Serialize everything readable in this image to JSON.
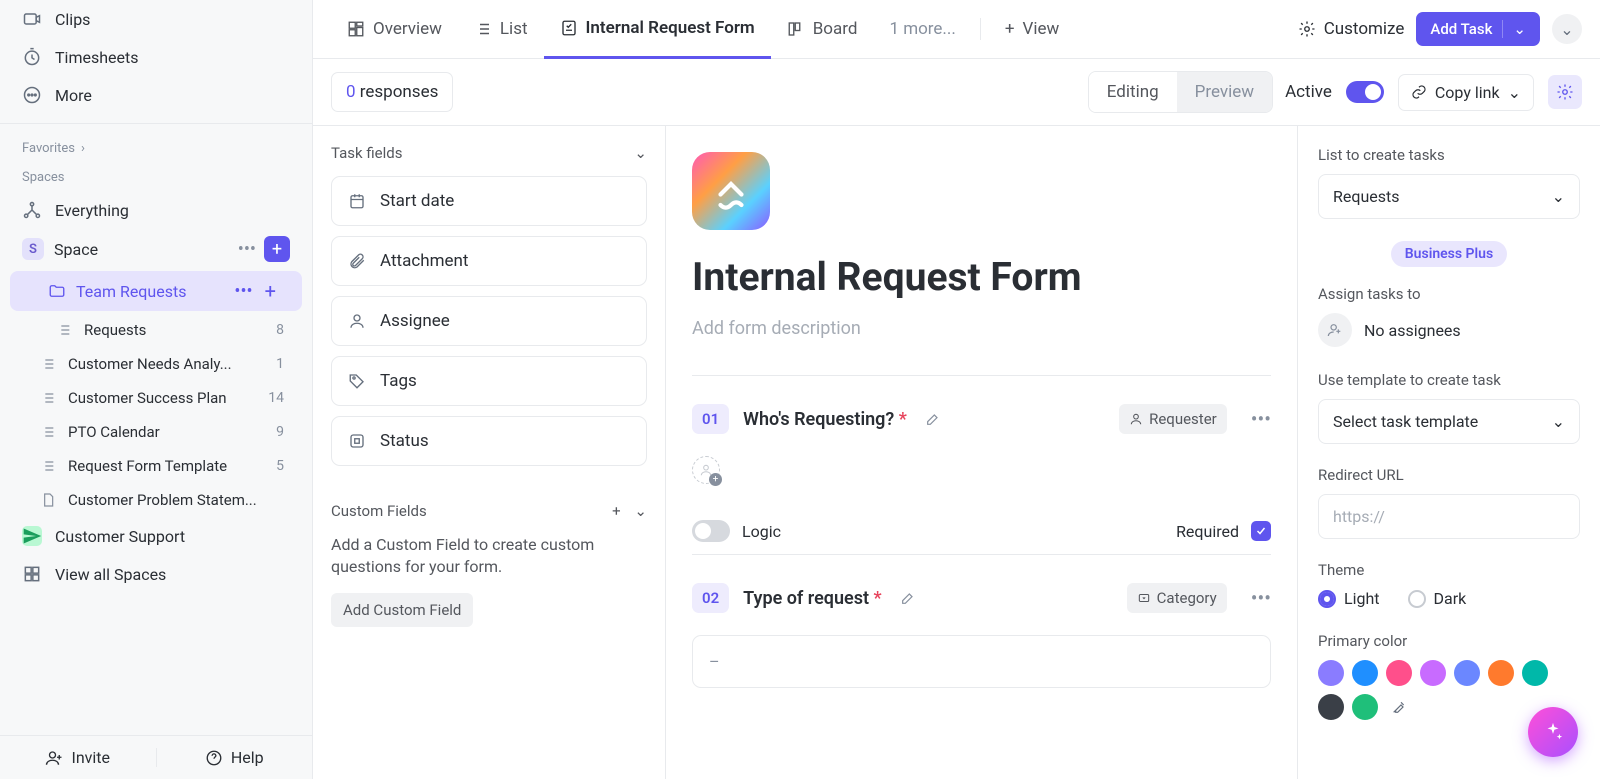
{
  "sidebar": {
    "items": [
      {
        "label": "Clips"
      },
      {
        "label": "Timesheets"
      },
      {
        "label": "More"
      }
    ],
    "favorites_label": "Favorites",
    "spaces_label": "Spaces",
    "everything": "Everything",
    "space": {
      "initial": "S",
      "name": "Space"
    },
    "folder": "Team Requests",
    "lists": [
      {
        "name": "Requests",
        "count": "8"
      },
      {
        "name": "Customer Needs Analy...",
        "count": "1"
      },
      {
        "name": "Customer Success Plan",
        "count": "14"
      },
      {
        "name": "PTO Calendar",
        "count": "9"
      },
      {
        "name": "Request Form Template",
        "count": "5"
      },
      {
        "name": "Customer Problem Statem..."
      }
    ],
    "support": "Customer Support",
    "view_all": "View all Spaces",
    "invite": "Invite",
    "help": "Help"
  },
  "tabs": {
    "overview": "Overview",
    "list": "List",
    "form": "Internal Request Form",
    "board": "Board",
    "more": "1 more...",
    "view": "View",
    "customize": "Customize",
    "add_task": "Add Task"
  },
  "subbar": {
    "responses_n": "0",
    "responses_label": " responses",
    "editing": "Editing",
    "preview": "Preview",
    "active": "Active",
    "copy": "Copy link"
  },
  "left_panel": {
    "task_fields": "Task fields",
    "fields": [
      "Start date",
      "Attachment",
      "Assignee",
      "Tags",
      "Status"
    ],
    "custom_fields": "Custom Fields",
    "hint": "Add a Custom Field to create custom questions for your form.",
    "add_btn": "Add Custom Field"
  },
  "form": {
    "title": "Internal Request Form",
    "desc_placeholder": "Add form description",
    "questions": [
      {
        "num": "01",
        "title": "Who's Requesting?",
        "badge": "Requester",
        "logic": "Logic",
        "required": "Required"
      },
      {
        "num": "02",
        "title": "Type of request",
        "badge": "Category",
        "placeholder": "–"
      }
    ]
  },
  "right_panel": {
    "list_label": "List to create tasks",
    "list_value": "Requests",
    "biz": "Business Plus",
    "assign_label": "Assign tasks to",
    "no_assignees": "No assignees",
    "template_label": "Use template to create task",
    "template_value": "Select task template",
    "redirect_label": "Redirect URL",
    "redirect_placeholder": "https://",
    "theme_label": "Theme",
    "light": "Light",
    "dark": "Dark",
    "primary_label": "Primary color",
    "colors": [
      "#8a7cff",
      "#1f8fff",
      "#ff4f8b",
      "#c86bff",
      "#6b87ff",
      "#ff7a2d",
      "#00b8a9",
      "#3a3f47",
      "#1fbf7a"
    ]
  }
}
